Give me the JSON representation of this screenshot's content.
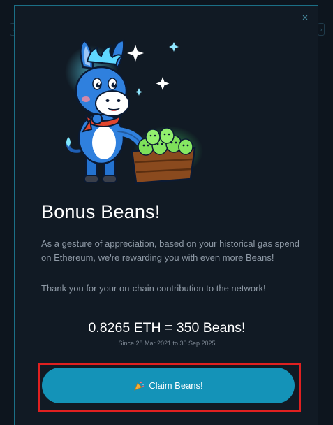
{
  "modal": {
    "close_icon": "×",
    "title": "Bonus Beans!",
    "description": "As a gesture of appreciation, based on your historical gas spend on Ethereum, we're rewarding you with even more Beans!",
    "thanks": "Thank you for your on-chain contribution to the network!",
    "conversion": "0.8265 ETH = 350 Beans!",
    "period": "Since 28 Mar 2021 to 30 Sep 2025",
    "claim_label": "Claim Beans!",
    "claim_icon": "party-popper-icon"
  },
  "colors": {
    "accent": "#1493b8",
    "modal_bg": "#111a24",
    "modal_border": "#1b6f86",
    "highlight": "#e02020"
  },
  "illustration": {
    "name": "donkey-mascot-with-bean-crate"
  }
}
